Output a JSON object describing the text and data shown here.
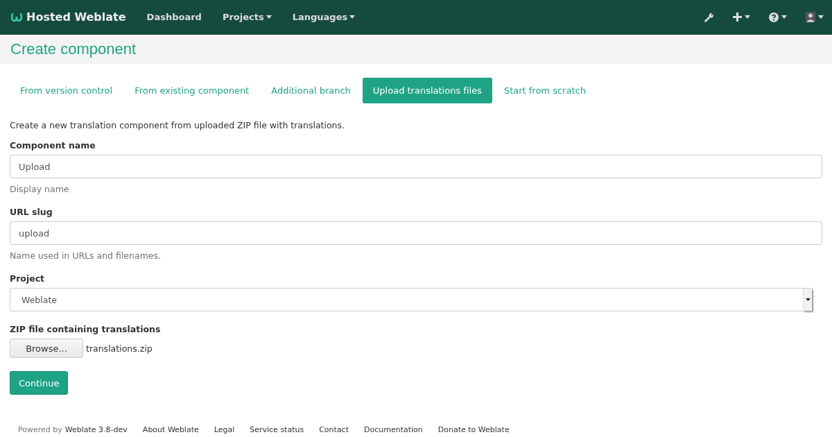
{
  "navbar": {
    "brand": "Hosted Weblate",
    "items": [
      {
        "label": "Dashboard",
        "dropdown": false
      },
      {
        "label": "Projects",
        "dropdown": true
      },
      {
        "label": "Languages",
        "dropdown": true
      }
    ],
    "tools": [
      {
        "kind": "wrench",
        "dropdown": false
      },
      {
        "kind": "plus",
        "dropdown": true
      },
      {
        "kind": "help",
        "dropdown": true
      },
      {
        "kind": "avatar",
        "dropdown": true
      }
    ]
  },
  "page_title": "Create component",
  "tabs": [
    {
      "label": "From version control",
      "selected": false
    },
    {
      "label": "From existing component",
      "selected": false
    },
    {
      "label": "Additional branch",
      "selected": false
    },
    {
      "label": "Upload translations files",
      "selected": true
    },
    {
      "label": "Start from scratch",
      "selected": false
    }
  ],
  "intro": "Create a new translation component from uploaded ZIP file with translations.",
  "fields": [
    {
      "kind": "text",
      "label": "Component name",
      "value": "Upload",
      "help": "Display name"
    },
    {
      "kind": "text",
      "label": "URL slug",
      "value": "upload",
      "help": "Name used in URLs and filenames."
    },
    {
      "kind": "select",
      "label": "Project",
      "value": "Weblate"
    },
    {
      "kind": "file",
      "label": "ZIP file containing translations",
      "button": "Browse...",
      "value": "translations.zip"
    }
  ],
  "submit": "Continue",
  "footer": {
    "powered_by": "Powered by",
    "version_link": "Weblate 3.8-dev",
    "links": [
      "About Weblate",
      "Legal",
      "Service status",
      "Contact",
      "Documentation",
      "Donate to Weblate"
    ]
  }
}
